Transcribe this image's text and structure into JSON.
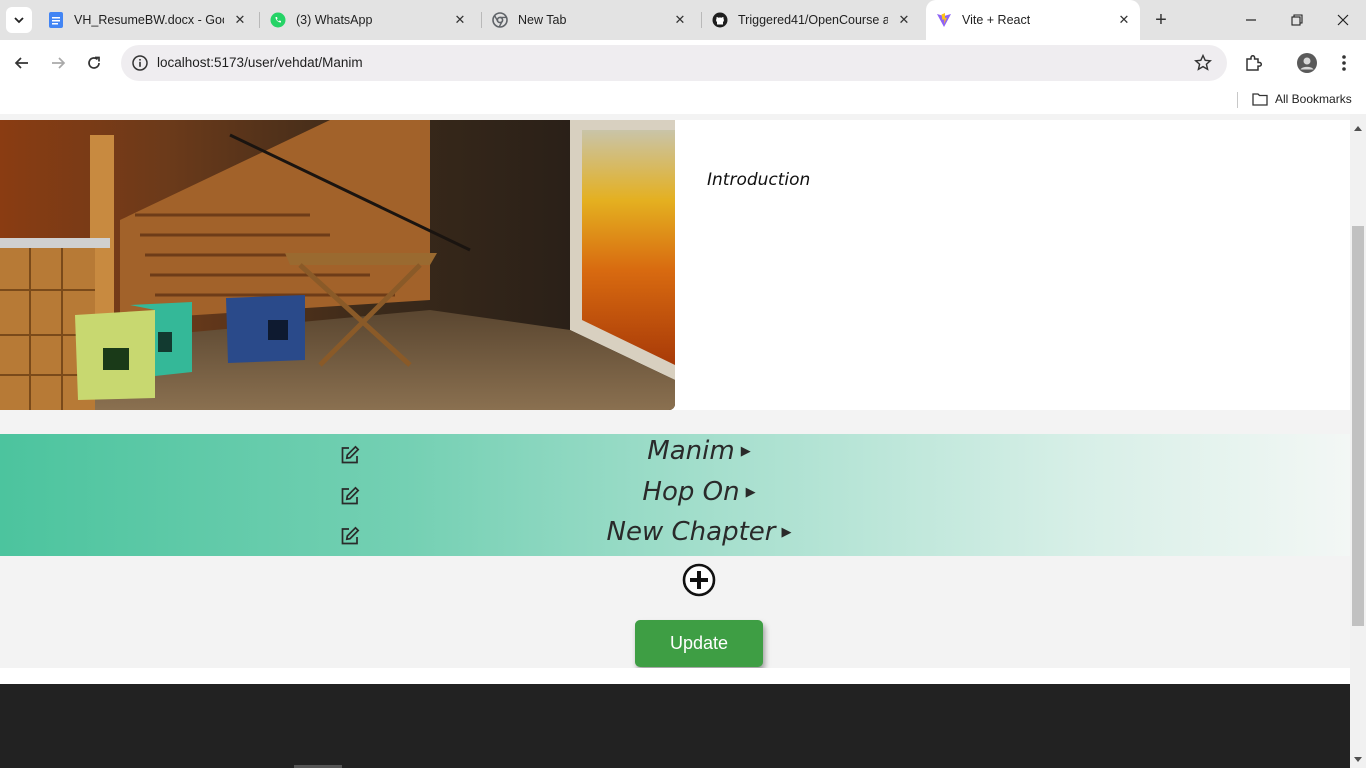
{
  "browser": {
    "tabs": [
      {
        "title": "VH_ResumeBW.docx - Goog",
        "icon": "google-docs-icon",
        "active": false
      },
      {
        "title": "(3) WhatsApp",
        "icon": "whatsapp-icon",
        "active": false
      },
      {
        "title": "New Tab",
        "icon": "chrome-icon",
        "active": false
      },
      {
        "title": "Triggered41/OpenCourse at",
        "icon": "github-icon",
        "active": false
      },
      {
        "title": "Vite + React",
        "icon": "vite-icon",
        "active": true
      }
    ],
    "url": "localhost:5173/user/vehdat/Manim",
    "bookmarks": {
      "all_label": "All Bookmarks"
    }
  },
  "course": {
    "description": "Introduction",
    "chapters": [
      {
        "title": "Manim"
      },
      {
        "title": "Hop On"
      },
      {
        "title": "New Chapter"
      }
    ],
    "update_label": "Update"
  },
  "colors": {
    "band_start": "#4cc49e",
    "band_end": "#f3f7f5",
    "update_button": "#3e9e44",
    "footer": "#222222"
  }
}
